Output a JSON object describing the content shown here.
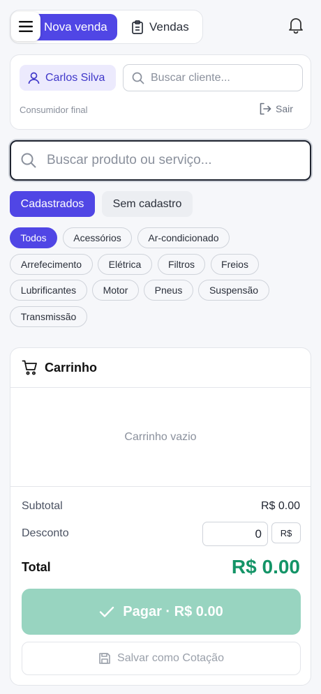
{
  "header": {
    "tabs": [
      {
        "label": "Nova venda",
        "active": true
      },
      {
        "label": "Vendas",
        "active": false
      }
    ],
    "icons": {
      "menu": "menu-icon",
      "sales": "clipboard-icon",
      "notifications": "bell-icon"
    }
  },
  "client": {
    "name": "Carlos Silva",
    "search_placeholder": "Buscar cliente...",
    "type": "Consumidor final",
    "logout_label": "Sair"
  },
  "product_search": {
    "placeholder": "Buscar produto ou serviço..."
  },
  "segments": [
    {
      "label": "Cadastrados",
      "active": true
    },
    {
      "label": "Sem cadastro",
      "active": false
    }
  ],
  "categories": [
    "Todos",
    "Acessórios",
    "Ar-condicionado",
    "Arrefecimento",
    "Elétrica",
    "Filtros",
    "Freios",
    "Lubrificantes",
    "Motor",
    "Pneus",
    "Suspensão",
    "Transmissão"
  ],
  "active_category": "Todos",
  "cart": {
    "title": "Carrinho",
    "empty_text": "Carrinho vazio",
    "subtotal_label": "Subtotal",
    "subtotal_value": "R$ 0.00",
    "discount_label": "Desconto",
    "discount_value": "0",
    "discount_currency": "R$",
    "total_label": "Total",
    "total_value": "R$ 0.00",
    "pay_label": "Pagar · R$ 0.00",
    "save_label": "Salvar como Cotação"
  },
  "colors": {
    "accent": "#5046e5",
    "total": "#149467",
    "pay_button": "#98d4c0"
  }
}
